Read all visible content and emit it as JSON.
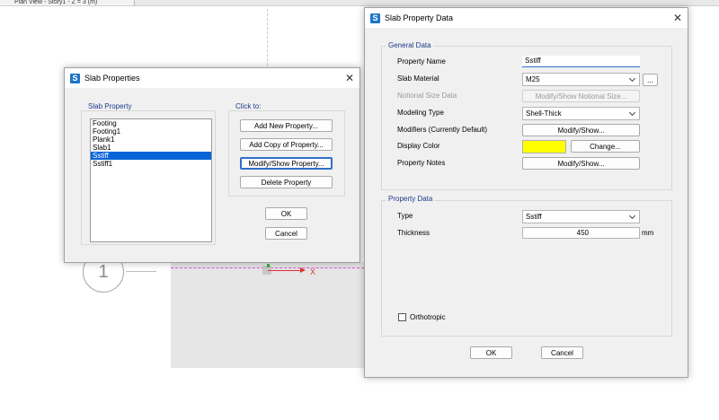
{
  "background": {
    "view_tab_title": "Plan View - Story1 - Z = 3 (m)",
    "grid_bubble_label": "1",
    "axis_label": "X"
  },
  "slab_properties": {
    "title": "Slab Properties",
    "property_group_label": "Slab Property",
    "click_group_label": "Click to:",
    "items": [
      "Footing",
      "Footing1",
      "Plank1",
      "Slab1",
      "Sstiff",
      "Sstiff1"
    ],
    "selected_index": 4,
    "buttons": {
      "add_new": "Add New Property...",
      "add_copy": "Add Copy of Property...",
      "modify_show": "Modify/Show Property...",
      "delete": "Delete Property",
      "ok": "OK",
      "cancel": "Cancel"
    }
  },
  "slab_property_data": {
    "title": "Slab Property Data",
    "general_group_label": "General Data",
    "labels": {
      "property_name": "Property Name",
      "slab_material": "Slab Material",
      "notional_size": "Notional Size Data",
      "modeling_type": "Modeling Type",
      "modifiers": "Modifiers (Currently Default)",
      "display_color": "Display Color",
      "property_notes": "Property Notes"
    },
    "values": {
      "property_name": "Sstiff",
      "slab_material": "M25",
      "modeling_type": "Shell-Thick"
    },
    "buttons": {
      "material_more": "...",
      "notional_size": "Modify/Show Notional Size...",
      "modifiers": "Modify/Show...",
      "change_color": "Change...",
      "notes": "Modify/Show...",
      "ok": "OK",
      "cancel": "Cancel"
    },
    "display_color_hex": "#FFFF00",
    "property_group_label": "Property Data",
    "type_label": "Type",
    "type_value": "Sstiff",
    "thickness_label": "Thickness",
    "thickness_value": "450",
    "thickness_unit": "mm",
    "orthotropic_label": "Orthotropic",
    "orthotropic_checked": false
  }
}
